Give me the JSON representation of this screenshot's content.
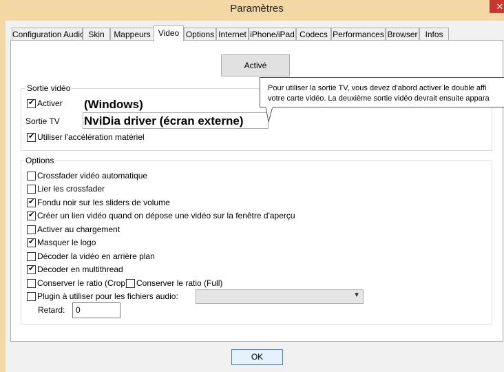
{
  "window": {
    "title": "Paramètres",
    "close_glyph": "✕"
  },
  "tabs": [
    {
      "label": "Configuration Audio"
    },
    {
      "label": "Skin"
    },
    {
      "label": "Mappeurs"
    },
    {
      "label": "Video"
    },
    {
      "label": "Options"
    },
    {
      "label": "Internet"
    },
    {
      "label": "iPhone/iPad"
    },
    {
      "label": "Codecs"
    },
    {
      "label": "Performances"
    },
    {
      "label": "Browser"
    },
    {
      "label": "Infos"
    }
  ],
  "active_tab": "Video",
  "video": {
    "active_button": "Activé",
    "sortie_group": {
      "title": "Sortie vidéo",
      "activer": {
        "label": "Activer",
        "checked": true
      },
      "windows_label": "(Windows)",
      "sortie_tv_label": "Sortie TV",
      "sortie_tv_value": "NviDia driver (écran externe)",
      "accel": {
        "label": "Utiliser l'accélération matériel",
        "checked": true
      }
    },
    "tooltip": {
      "line1": "Pour utiliser la sortie TV, vous devez d'abord activer le double affi",
      "line2": "votre carte vidéo. La deuxième sortie vidéo devrait ensuite appara"
    },
    "options_group": {
      "title": "Options",
      "items": [
        {
          "label": "Crossfader vidéo automatique",
          "checked": false
        },
        {
          "label": "Lier les crossfader",
          "checked": false
        },
        {
          "label": "Fondu noir sur les sliders de volume",
          "checked": true
        },
        {
          "label": "Créer un lien vidéo quand on dépose une vidéo sur la fenêtre d'aperçu",
          "checked": true
        },
        {
          "label": "Activer au chargement",
          "checked": false
        },
        {
          "label": "Masquer le logo",
          "checked": true
        },
        {
          "label": "Décoder la vidéo en arrière plan",
          "checked": false
        },
        {
          "label": "Decoder en multithread",
          "checked": true
        }
      ],
      "ratio_crop": {
        "label": "Conserver le ratio (Crop)",
        "checked": false
      },
      "ratio_full": {
        "label": "Conserver le ratio (Full)",
        "checked": false
      },
      "plugin": {
        "label": "Plugin à utiliser pour les fichiers audio:",
        "checked": false,
        "value": ""
      },
      "retard": {
        "label": "Retard:",
        "value": "0"
      }
    }
  },
  "footer": {
    "ok_label": "OK"
  }
}
